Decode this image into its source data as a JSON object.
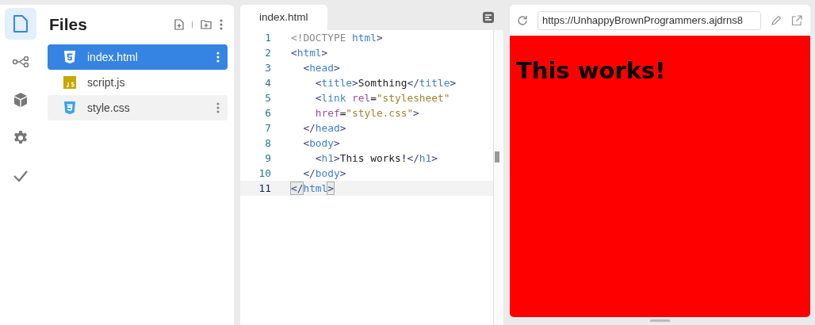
{
  "activity_bar": [
    {
      "selected": true
    },
    {
      "selected": false
    },
    {
      "selected": false
    },
    {
      "selected": false
    },
    {
      "selected": false
    }
  ],
  "files": {
    "title": "Files",
    "items": [
      {
        "name": "index.html",
        "kind": "html",
        "selected": true,
        "hovered": false
      },
      {
        "name": "script.js",
        "kind": "js",
        "selected": false,
        "hovered": false
      },
      {
        "name": "style.css",
        "kind": "css",
        "selected": false,
        "hovered": true
      }
    ]
  },
  "editor": {
    "tabs": [
      {
        "label": "index.html",
        "selected": true
      }
    ],
    "lines": [
      {
        "number": "1",
        "selected": false,
        "tokens": [
          {
            "kind": "doctype",
            "text": "<!DOCTYPE"
          },
          {
            "kind": "tag",
            "text": " html"
          },
          {
            "kind": "bracket",
            "text": ">"
          }
        ]
      },
      {
        "number": "2",
        "selected": false,
        "tokens": [
          {
            "kind": "bracket",
            "text": "<"
          },
          {
            "kind": "tag",
            "text": "html"
          },
          {
            "kind": "bracket",
            "text": ">"
          }
        ]
      },
      {
        "number": "3",
        "selected": false,
        "tokens": [
          {
            "kind": "bracket",
            "text": "  <"
          },
          {
            "kind": "tag",
            "text": "head"
          },
          {
            "kind": "bracket",
            "text": ">"
          }
        ]
      },
      {
        "number": "4",
        "selected": false,
        "tokens": [
          {
            "kind": "bracket",
            "text": "    <"
          },
          {
            "kind": "tag",
            "text": "title"
          },
          {
            "kind": "bracket",
            "text": ">"
          },
          {
            "kind": "text",
            "text": "Somthing"
          },
          {
            "kind": "bracket",
            "text": "</"
          },
          {
            "kind": "tag",
            "text": "title"
          },
          {
            "kind": "bracket",
            "text": ">"
          }
        ]
      },
      {
        "number": "5",
        "selected": false,
        "tokens": [
          {
            "kind": "bracket",
            "text": "    <"
          },
          {
            "kind": "tag",
            "text": "link "
          },
          {
            "kind": "attr",
            "text": "rel"
          },
          {
            "kind": "text",
            "text": "="
          },
          {
            "kind": "string",
            "text": "\"stylesheet\""
          }
        ]
      },
      {
        "number": "6",
        "selected": false,
        "tokens": [
          {
            "kind": "attr",
            "text": "    href"
          },
          {
            "kind": "text",
            "text": "="
          },
          {
            "kind": "string",
            "text": "\"style.css\""
          },
          {
            "kind": "bracket",
            "text": ">"
          }
        ]
      },
      {
        "number": "7",
        "selected": false,
        "tokens": [
          {
            "kind": "bracket",
            "text": "  </"
          },
          {
            "kind": "tag",
            "text": "head"
          },
          {
            "kind": "bracket",
            "text": ">"
          }
        ]
      },
      {
        "number": "8",
        "selected": false,
        "tokens": [
          {
            "kind": "bracket",
            "text": "  <"
          },
          {
            "kind": "tag",
            "text": "body"
          },
          {
            "kind": "bracket",
            "text": ">"
          }
        ]
      },
      {
        "number": "9",
        "selected": false,
        "tokens": [
          {
            "kind": "bracket",
            "text": "    <"
          },
          {
            "kind": "tag",
            "text": "h1"
          },
          {
            "kind": "bracket",
            "text": ">"
          },
          {
            "kind": "text",
            "text": "This works!"
          },
          {
            "kind": "bracket",
            "text": "</"
          },
          {
            "kind": "tag",
            "text": "h1"
          },
          {
            "kind": "bracket",
            "text": ">"
          }
        ]
      },
      {
        "number": "10",
        "selected": false,
        "tokens": [
          {
            "kind": "bracket",
            "text": "  </"
          },
          {
            "kind": "tag",
            "text": "body"
          },
          {
            "kind": "bracket",
            "text": ">"
          }
        ]
      },
      {
        "number": "11",
        "selected": true,
        "tokens": [
          {
            "kind": "bracket",
            "text": "</",
            "matched": true
          },
          {
            "kind": "tag",
            "text": "html"
          },
          {
            "kind": "bracket",
            "text": ">",
            "matched": true
          }
        ]
      }
    ]
  },
  "preview": {
    "url": "https://UnhappyBrownProgrammers.ajdrns8",
    "heading": "This works!"
  }
}
